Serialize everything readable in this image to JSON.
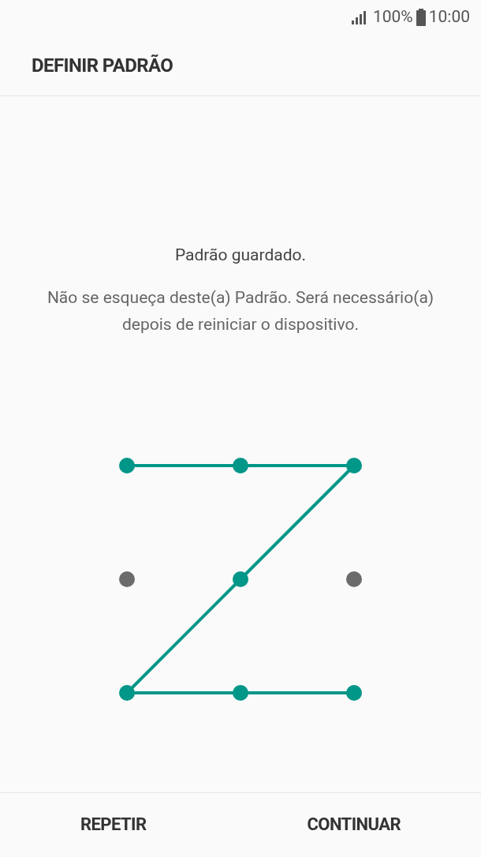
{
  "status_bar": {
    "battery": "100%",
    "time": "10:00"
  },
  "header": {
    "title": "DEFINIR PADRÃO"
  },
  "message": {
    "title": "Padrão guardado.",
    "body": "Não se esqueça deste(a) Padrão. Será necessário(a) depois de reiniciar o dispositivo."
  },
  "pattern": {
    "dots": [
      {
        "selected": true
      },
      {
        "selected": true
      },
      {
        "selected": true
      },
      {
        "selected": false
      },
      {
        "selected": true
      },
      {
        "selected": false
      },
      {
        "selected": true
      },
      {
        "selected": true
      },
      {
        "selected": true
      }
    ]
  },
  "buttons": [
    {
      "label": "REPETIR"
    },
    {
      "label": "CONTINUAR"
    }
  ]
}
